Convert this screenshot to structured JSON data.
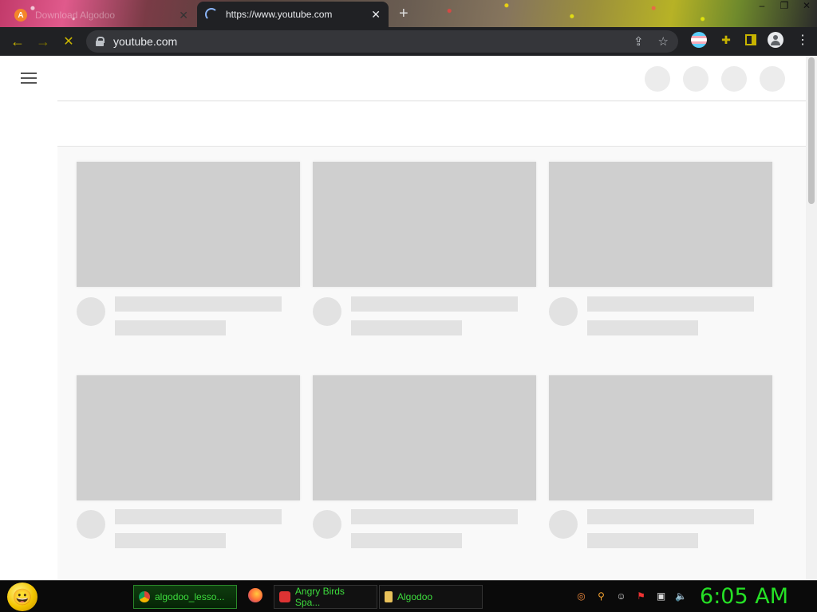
{
  "browser": {
    "tabs": [
      {
        "title": "Download Algodoo",
        "active": false
      },
      {
        "title": "https://www.youtube.com",
        "active": true
      }
    ],
    "new_tab_symbol": "+",
    "close_symbol": "✕",
    "window_controls": [
      "–",
      "❐",
      "✕"
    ],
    "address": "youtube.com",
    "nav": {
      "back": "←",
      "forward": "→",
      "stop": "✕"
    },
    "omnibox_icons": [
      "share-icon",
      "star-icon"
    ],
    "extensions": [
      "flag-extension-icon",
      "puzzle-icon",
      "side-panel-icon",
      "profile-avatar-icon",
      "kebab-menu-icon"
    ],
    "accent_color": "#c8b400"
  },
  "youtube": {
    "state": "loading-skeleton",
    "masthead_placeholders": 4,
    "grid": {
      "rows": 2,
      "columns": 3
    }
  },
  "taskbar": {
    "tasks": [
      {
        "label": "algodoo_lesso...",
        "icon": "chrome-icon",
        "active": true
      },
      {
        "label": "Angry Birds Spa...",
        "icon": "angry-birds-icon",
        "active": false
      },
      {
        "label": "Algodoo",
        "icon": "algodoo-icon",
        "active": false
      }
    ],
    "tray_icons": [
      "target-icon",
      "search-icon",
      "chat-icon",
      "flag-icon",
      "network-icon",
      "volume-icon"
    ],
    "clock": "6:05 AM"
  }
}
